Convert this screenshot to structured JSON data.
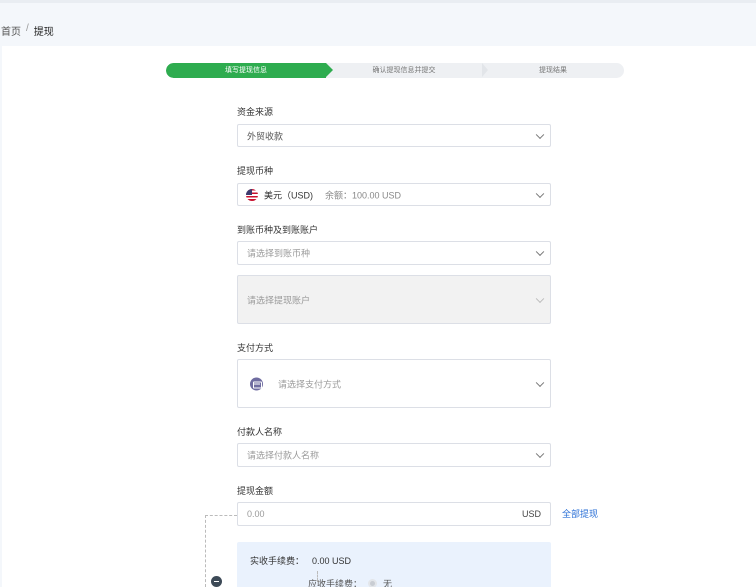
{
  "breadcrumb": {
    "home": "首页",
    "separator": "/",
    "current": "提现"
  },
  "steps": [
    "填写提现信息",
    "确认提现信息并提交",
    "提现结果"
  ],
  "form": {
    "fund_source": {
      "label": "资金来源",
      "value": "外贸收款"
    },
    "currency": {
      "label": "提现币种",
      "value": "美元（USD)",
      "balance": "余额：100.00 USD",
      "flag_icon": "us-flag-icon"
    },
    "arrival": {
      "label": "到账币种及到账账户",
      "currency_placeholder": "请选择到账币种",
      "account_placeholder": "请选择提现账户"
    },
    "payment": {
      "label": "支付方式",
      "placeholder": "请选择支付方式",
      "icon": "card-icon"
    },
    "payer": {
      "label": "付款人名称",
      "placeholder": "请选择付款人名称"
    },
    "amount": {
      "label": "提现金额",
      "placeholder": "0.00",
      "unit": "USD",
      "all_link": "全部提现"
    },
    "fees": {
      "actual_label": "实收手续费：",
      "actual_value": "0.00 USD",
      "due_label": "应收手续费：",
      "due_value": "无"
    }
  },
  "colors": {
    "accent_green": "#2eac4f",
    "link_blue": "#2a6fd6",
    "fee_bg": "#eaf2fd"
  }
}
